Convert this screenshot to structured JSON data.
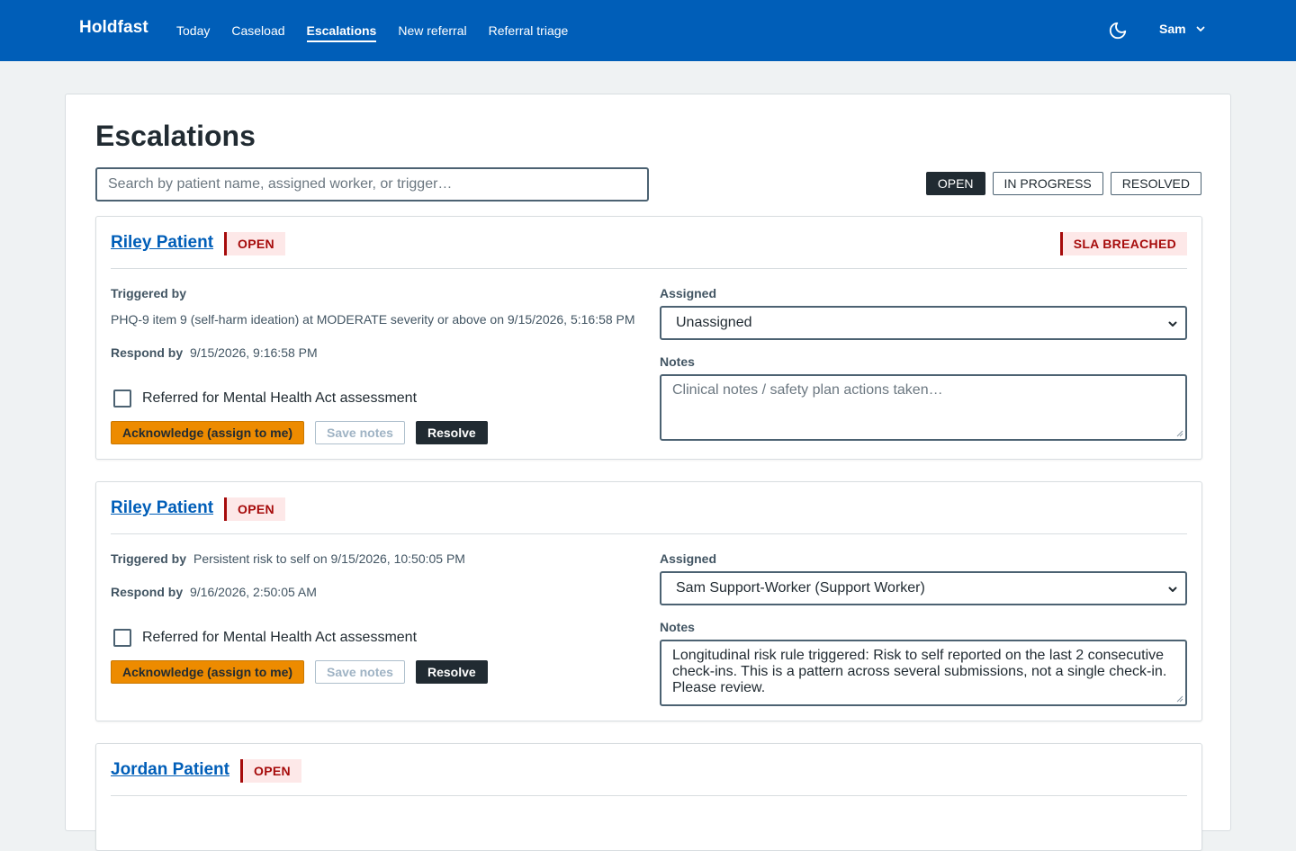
{
  "app": {
    "brand": "Holdfast"
  },
  "nav": {
    "items": [
      {
        "label": "Today",
        "active": false
      },
      {
        "label": "Caseload",
        "active": false
      },
      {
        "label": "Escalations",
        "active": true
      },
      {
        "label": "New referral",
        "active": false
      },
      {
        "label": "Referral triage",
        "active": false
      }
    ],
    "theme_icon": "moon-icon",
    "user": "Sam"
  },
  "page": {
    "title": "Escalations",
    "search_placeholder": "Search by patient name, assigned worker, or trigger…",
    "filters": [
      {
        "label": "OPEN",
        "active": true
      },
      {
        "label": "IN PROGRESS",
        "active": false
      },
      {
        "label": "RESOLVED",
        "active": false
      }
    ]
  },
  "labels": {
    "triggered_by": "Triggered by",
    "respond_by": "Respond by",
    "assigned": "Assigned",
    "notes": "Notes",
    "mha_checkbox": "Referred for Mental Health Act assessment",
    "acknowledge": "Acknowledge (assign to me)",
    "save_notes": "Save notes",
    "resolve": "Resolve",
    "notes_placeholder": "Clinical notes / safety plan actions taken…"
  },
  "escalations": [
    {
      "patient": "Riley Patient",
      "status": "OPEN",
      "sla": "SLA BREACHED",
      "trigger": "PHQ-9 item 9 (self-harm ideation) at MODERATE severity or above on 9/15/2026, 5:16:58 PM",
      "respond_by": "9/15/2026, 9:16:58 PM",
      "assigned": "Unassigned",
      "notes": ""
    },
    {
      "patient": "Riley Patient",
      "status": "OPEN",
      "sla": "",
      "trigger": "Persistent risk to self on 9/15/2026, 10:50:05 PM",
      "respond_by": "9/16/2026, 2:50:05 AM",
      "assigned": "Sam Support-Worker (Support Worker)",
      "notes": "Longitudinal risk rule triggered: Risk to self reported on the last 2 consecutive check-ins. This is a pattern across several submissions, not a single check-in. Please review."
    },
    {
      "patient": "Jordan Patient",
      "status": "OPEN",
      "sla": ""
    }
  ],
  "colors": {
    "header_bg": "#005eb8",
    "link": "#005eb8",
    "badge_text": "#a60b0b",
    "badge_bg": "#fde8e8",
    "acknowledge_bg": "#ed8b00",
    "resolve_bg": "#212b32",
    "page_bg": "#eff2f3"
  }
}
